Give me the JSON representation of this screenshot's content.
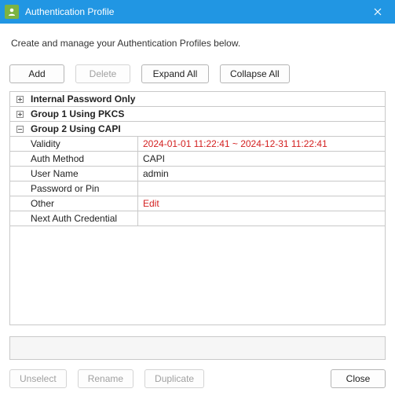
{
  "window": {
    "title": "Authentication Profile"
  },
  "instruction": "Create and manage your Authentication Profiles below.",
  "buttons": {
    "add": "Add",
    "delete": "Delete",
    "expand_all": "Expand All",
    "collapse_all": "Collapse All",
    "unselect": "Unselect",
    "rename": "Rename",
    "duplicate": "Duplicate",
    "close": "Close"
  },
  "groups": {
    "g0": {
      "label": "Internal Password Only",
      "expanded": false
    },
    "g1": {
      "label": "Group 1 Using PKCS",
      "expanded": false
    },
    "g2": {
      "label": "Group 2 Using CAPI",
      "expanded": true
    }
  },
  "g2rows": {
    "validity": {
      "key": "Validity",
      "val": "2024-01-01 11:22:41 ~ 2024-12-31 11:22:41",
      "red": true
    },
    "auth_method": {
      "key": "Auth Method",
      "val": "CAPI"
    },
    "user_name": {
      "key": "User Name",
      "val": "admin"
    },
    "password_or_pin": {
      "key": "Password or Pin",
      "val": ""
    },
    "other": {
      "key": "Other",
      "val": "Edit",
      "red": true
    },
    "next": {
      "key": "Next Auth Credential",
      "val": ""
    }
  }
}
